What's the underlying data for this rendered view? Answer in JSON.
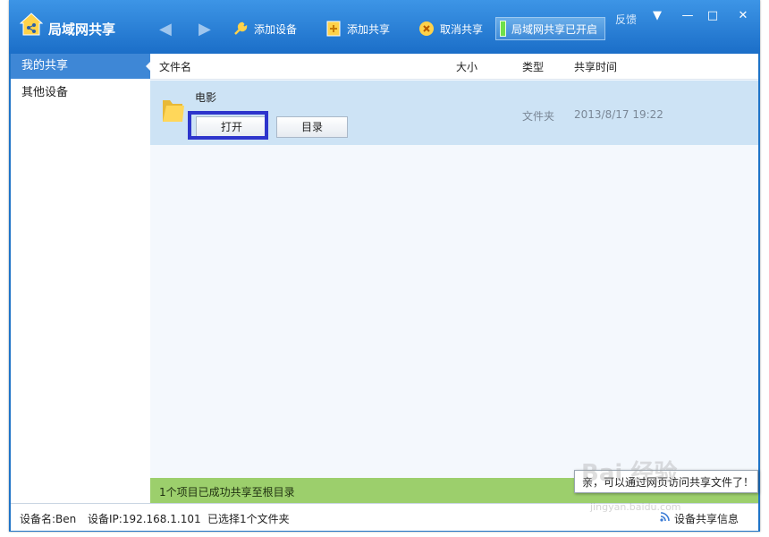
{
  "app": {
    "title": "局域网共享"
  },
  "toolbar": {
    "back_label": "◀",
    "forward_label": "▶",
    "add_device": "添加设备",
    "add_share": "添加共享",
    "cancel_share": "取消共享",
    "status": "局域网共享已开启",
    "feedback": "反馈"
  },
  "window_controls": {
    "menu": "▼",
    "minimize": "—",
    "maximize": "□",
    "close": "✕"
  },
  "sidebar": {
    "items": [
      {
        "label": "我的共享"
      },
      {
        "label": "其他设备"
      }
    ]
  },
  "table": {
    "headers": {
      "name": "文件名",
      "size": "大小",
      "type": "类型",
      "time": "共享时间"
    },
    "rows": [
      {
        "name": "电影",
        "size": "",
        "type": "文件夹",
        "time": "2013/8/17 19:22",
        "open_button": "打开",
        "dir_button": "目录"
      }
    ]
  },
  "notice": "1个项目已成功共享至根目录",
  "tooltip": "亲，可以通过网页访问共享文件了！",
  "statusbar": {
    "device_name": "设备名:Ben",
    "device_ip": "设备IP:192.168.1.101",
    "selection": "已选择1个文件夹",
    "share_info": "设备共享信息"
  },
  "watermark": {
    "logo": "Bai 经验",
    "url": "jingyan.baidu.com"
  },
  "colors": {
    "titlebar": "#1b6ec8",
    "selected_row": "#cde3f5",
    "notice_bar": "#9ccf6c",
    "highlight": "#2d35cc"
  }
}
